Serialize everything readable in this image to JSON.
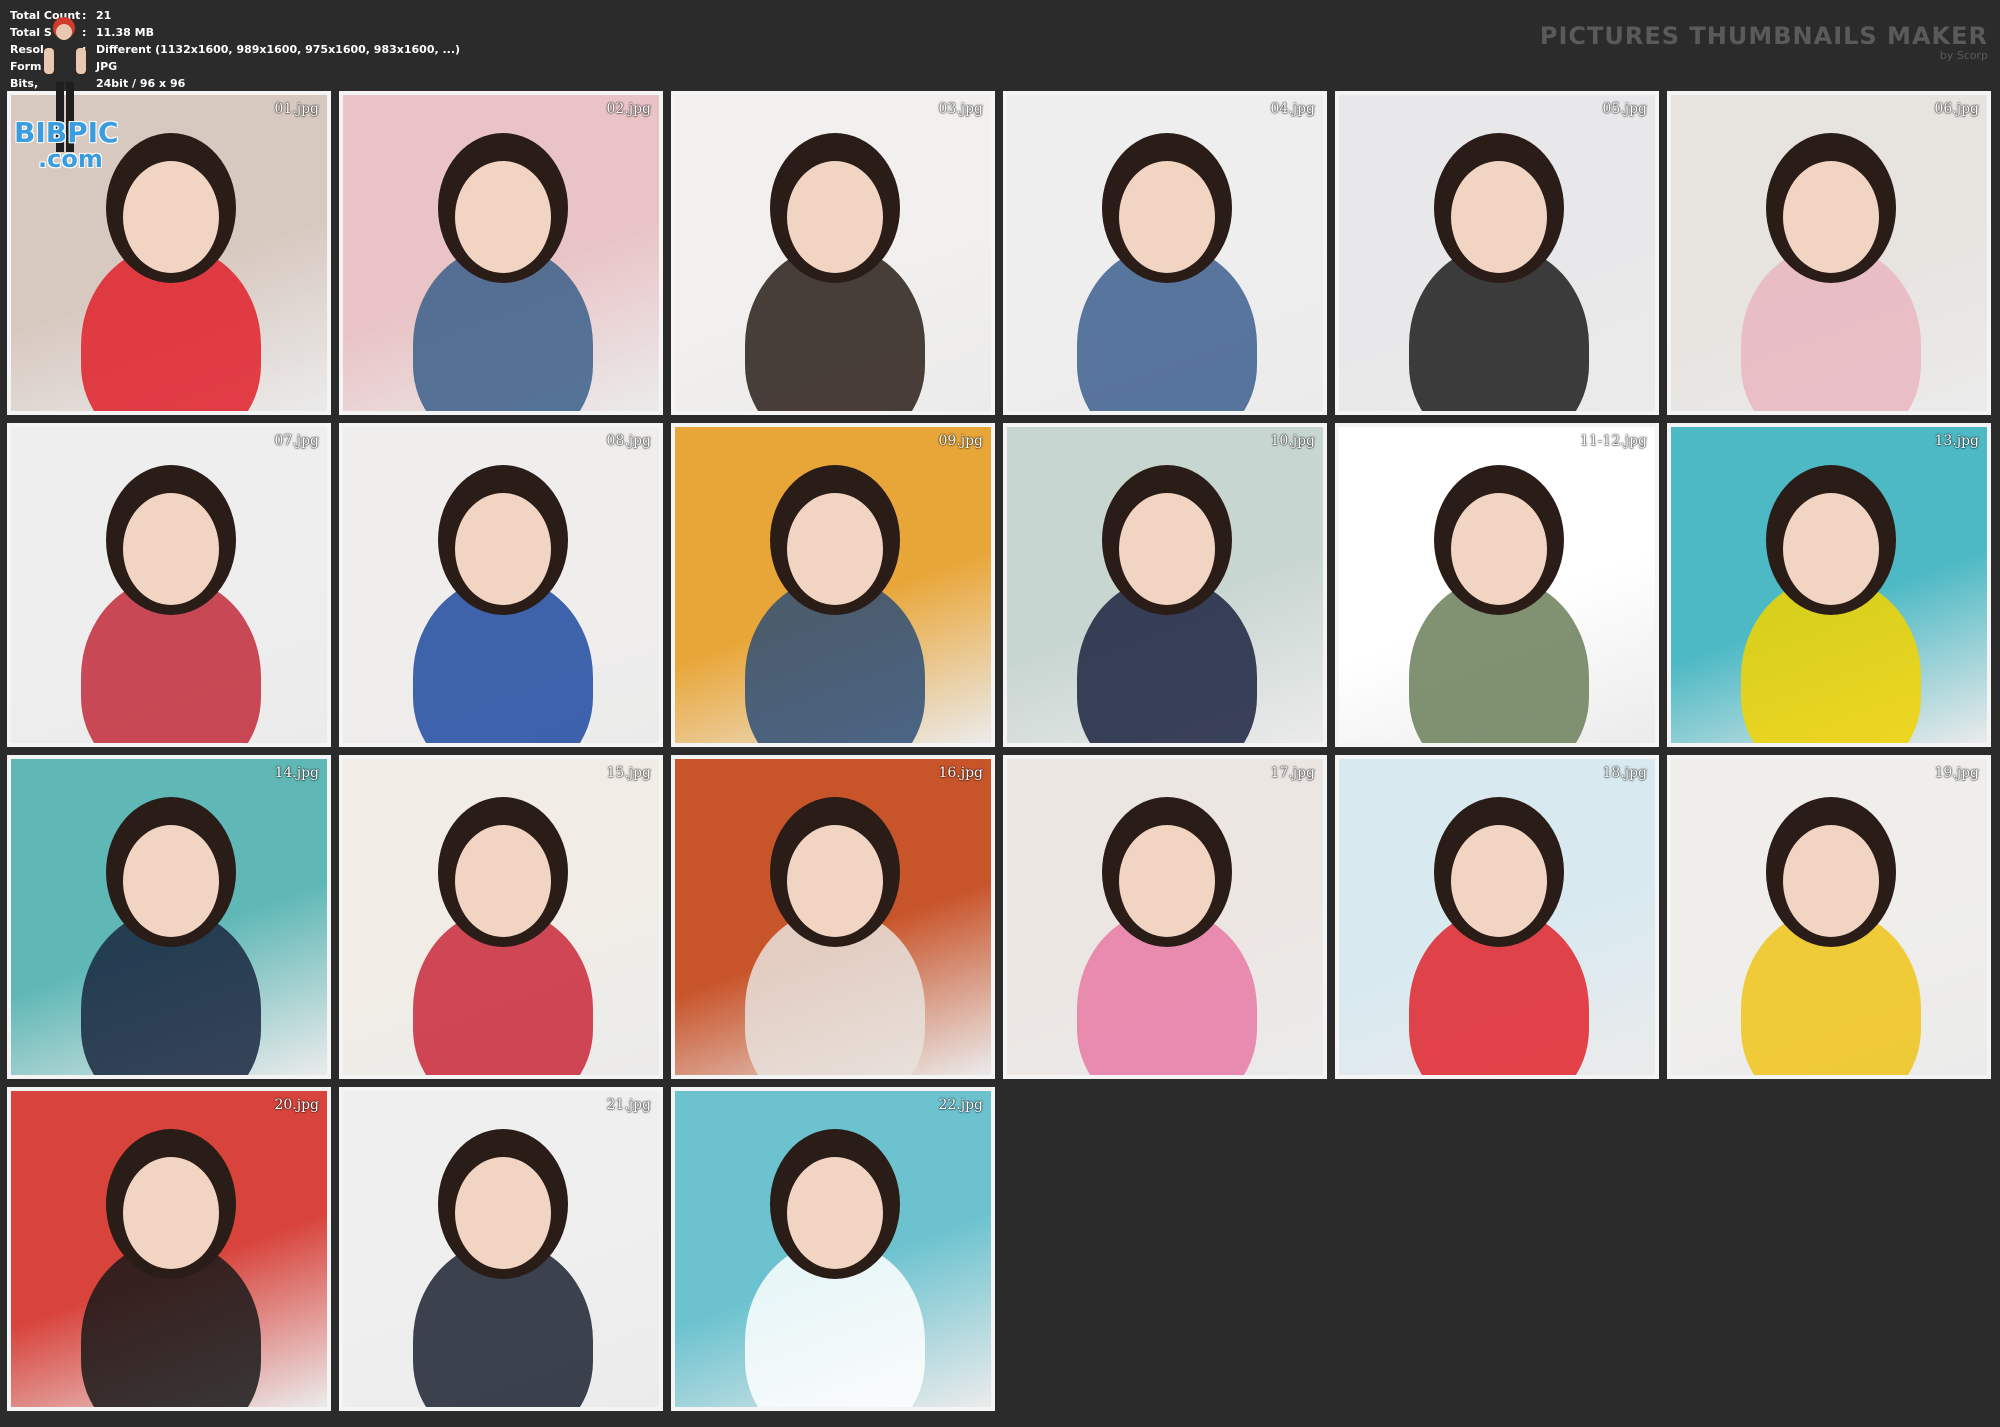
{
  "info": {
    "rows": [
      {
        "key": "Total Count",
        "sep": ":",
        "value": "21"
      },
      {
        "key": "Total S",
        "sep": ":",
        "value": "11.38 MB"
      },
      {
        "key": "Resol",
        "sep": ":",
        "value": "Different (1132x1600, 989x1600, 975x1600, 983x1600, ...)"
      },
      {
        "key": "Form",
        "sep": "",
        "value": "JPG"
      },
      {
        "key": "Bits,",
        "sep": "",
        "value": "24bit / 96 x 96"
      }
    ]
  },
  "brand": {
    "title": "PICTURES THUMBNAILS MAKER",
    "by": "by Scorp"
  },
  "watermark": {
    "line1": "BIBPIC",
    "line2": ".com"
  },
  "thumbnails": [
    {
      "label": "01.jpg",
      "bg": "#d8c9c0",
      "accent": "#e0202a"
    },
    {
      "label": "02.jpg",
      "bg": "#e9c3c5",
      "accent": "#3b5f8a"
    },
    {
      "label": "03.jpg",
      "bg": "#f2f0ee",
      "accent": "#2a1e18"
    },
    {
      "label": "04.jpg",
      "bg": "#eeeeee",
      "accent": "#3d5f8e"
    },
    {
      "label": "05.jpg",
      "bg": "#e8e8ea",
      "accent": "#1c1c1c"
    },
    {
      "label": "06.jpg",
      "bg": "#e7e3df",
      "accent": "#e9b6c0"
    },
    {
      "label": "07.jpg",
      "bg": "#eeeeee",
      "accent": "#c22a3a"
    },
    {
      "label": "08.jpg",
      "bg": "#f0eeec",
      "accent": "#1f4aa0"
    },
    {
      "label": "09.jpg",
      "bg": "#e9a638",
      "accent": "#2f4f77"
    },
    {
      "label": "10.jpg",
      "bg": "#c8d6d1",
      "accent": "#1b2340"
    },
    {
      "label": "11-12.jpg",
      "bg": "#ffffff",
      "accent": "#6b7f5a"
    },
    {
      "label": "13.jpg",
      "bg": "#4cb9c4",
      "accent": "#f2d400"
    },
    {
      "label": "14.jpg",
      "bg": "#5fb8b6",
      "accent": "#1a2740"
    },
    {
      "label": "15.jpg",
      "bg": "#f1ede6",
      "accent": "#c9283a"
    },
    {
      "label": "16.jpg",
      "bg": "#c8542a",
      "accent": "#e8e2dc"
    },
    {
      "label": "17.jpg",
      "bg": "#ece6e2",
      "accent": "#e87aa6"
    },
    {
      "label": "18.jpg",
      "bg": "#d8eaf0",
      "accent": "#e0242c"
    },
    {
      "label": "19.jpg",
      "bg": "#efeeeb",
      "accent": "#f0c419"
    },
    {
      "label": "20.jpg",
      "bg": "#d8443c",
      "accent": "#1a1a1a"
    },
    {
      "label": "21.jpg",
      "bg": "#efefef",
      "accent": "#1b2230"
    },
    {
      "label": "22.jpg",
      "bg": "#6cc3cf",
      "accent": "#ffffff"
    }
  ]
}
